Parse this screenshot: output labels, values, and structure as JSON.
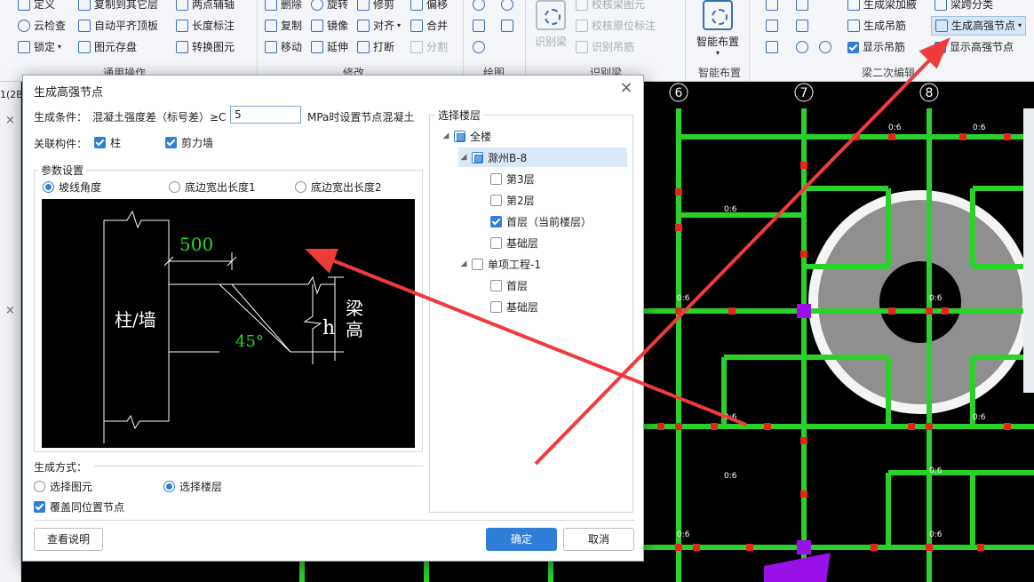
{
  "ribbon": {
    "g1": {
      "items": [
        "定义",
        "云检查",
        "锁定"
      ],
      "suffix_items": [
        "复制到其它层",
        "自动平齐顶板",
        "图元存盘"
      ],
      "items3": [
        "两点辅轴",
        "长度标注",
        "转换图元"
      ],
      "label": "通用操作"
    },
    "g2": {
      "items": [
        "删除",
        "复制",
        "移动",
        "旋转",
        "镜像",
        "延伸",
        "修剪",
        "对齐",
        "打断",
        "偏移",
        "合并",
        "分割"
      ],
      "label": "修改"
    },
    "g3": {
      "label": "绘图"
    },
    "g4": {
      "items": [
        "识别梁",
        "校核梁图元",
        "校核原位标注",
        "识别吊筋"
      ],
      "label": "识别梁"
    },
    "g5": {
      "big": "智能布置",
      "label": "智能布置"
    },
    "g6": {
      "items": [
        "生成梁加腋",
        "生成吊筋",
        "显示吊筋",
        "梁跨分类",
        "生成高强节点",
        "显示高强节点"
      ],
      "label": "梁二次编辑"
    }
  },
  "left_tab": "1(2B",
  "dialog": {
    "title": "生成高强节点",
    "condition_label": "生成条件：",
    "condition_text": "混凝土强度差（标号差）≥C",
    "condition_value": "5",
    "condition_suffix": "MPa时设置节点混凝土",
    "related_label": "关联构件：",
    "related_column": "柱",
    "related_wall": "剪力墙",
    "param_title": "参数设置",
    "radio_slope": "坡线角度",
    "radio_bottom1": "底边宽出长度1",
    "radio_bottom2": "底边宽出长度2",
    "diagram": {
      "dim": "500",
      "angle": "45°",
      "h": "h",
      "col_wall": "柱/墙",
      "beam_h1": "梁",
      "beam_h2": "高"
    },
    "method_label": "生成方式：",
    "method_elem": "选择图元",
    "method_floor": "选择楼层",
    "overwrite": "覆盖同位置节点",
    "help_btn": "查看说明",
    "ok_btn": "确定",
    "cancel_btn": "取消",
    "floor_title": "选择楼层",
    "tree": {
      "all": "全楼",
      "proj1": "滁州B-8",
      "f3": "第3层",
      "f2": "第2层",
      "f1": "首层（当前楼层）",
      "base": "基础层",
      "proj2": "单项工程-1",
      "p2f1": "首层",
      "p2base": "基础层"
    }
  },
  "canvas": {
    "axes": [
      "6",
      "7",
      "8"
    ],
    "beam_label": "0:6",
    "colors": {
      "beam": "#2bd12b",
      "node": "#e8221e",
      "column": "#9a10e8",
      "slab": "#8f8f8f",
      "arrow": "#ef3b3b"
    }
  }
}
